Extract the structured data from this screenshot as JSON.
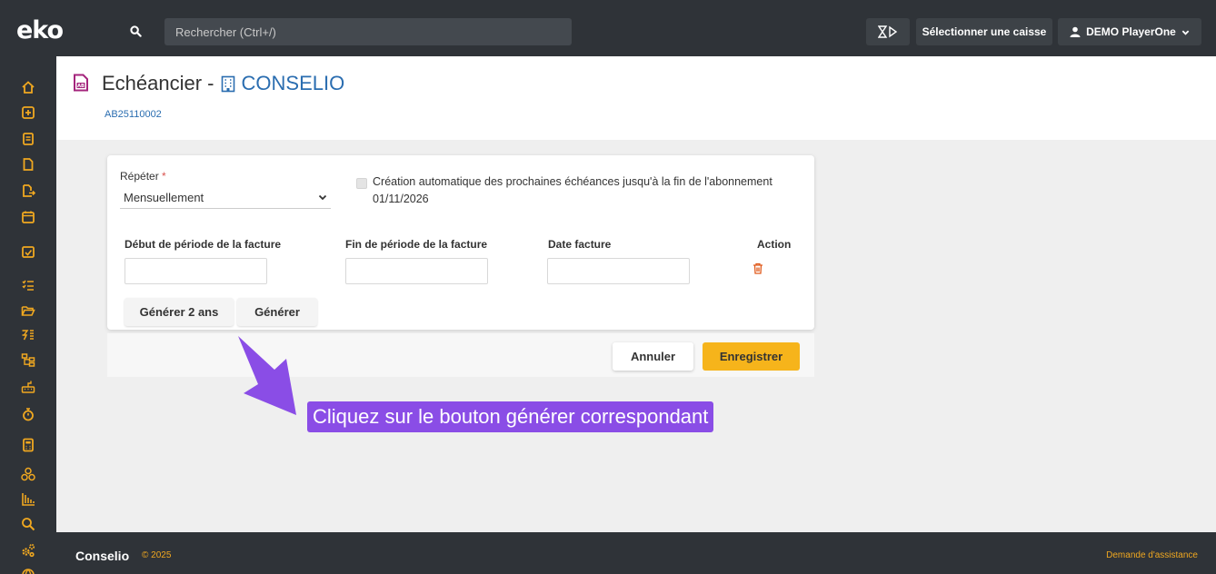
{
  "topbar": {
    "logo": "eko",
    "search_placeholder": "Rechercher (Ctrl+/)",
    "caisse_label": "Sélectionner une caisse",
    "user_label": "DEMO PlayerOne"
  },
  "sidebar": {
    "icons": [
      "home-icon",
      "plus-box-icon",
      "list-doc-icon",
      "file-icon",
      "file-export-icon",
      "calendar-icon",
      "calendar-check-icon",
      "checklist-icon",
      "folder-open-icon",
      "tasks-icon",
      "hierarchy-icon",
      "keyboard-icon",
      "stopwatch-icon",
      "calculator-icon",
      "network-icon",
      "bar-chart-icon",
      "search-icon",
      "cogs-icon",
      "globe-icon"
    ],
    "accent_color": "#f0a820"
  },
  "header": {
    "title": "Echéancier -",
    "company": "CONSELIO",
    "reference": "AB25110002"
  },
  "form": {
    "repeat_label": "Répéter",
    "required_mark": "*",
    "repeat_value": "Mensuellement",
    "auto_label": "Création automatique des prochaines échéances jusqu'à la fin de l'abonnement",
    "auto_date": "01/11/2026",
    "columns": {
      "start": "Début de période de la facture",
      "end": "Fin de période de la facture",
      "date": "Date facture",
      "action": "Action"
    },
    "generate_2y_label": "Générer 2 ans",
    "generate_label": "Générer",
    "cancel_label": "Annuler",
    "save_label": "Enregistrer"
  },
  "tooltip": {
    "text": "Cliquez sur le bouton générer correspondant"
  },
  "footer": {
    "brand": "Conselio",
    "year": "© 2025",
    "assist": "Demande d'assistance"
  }
}
